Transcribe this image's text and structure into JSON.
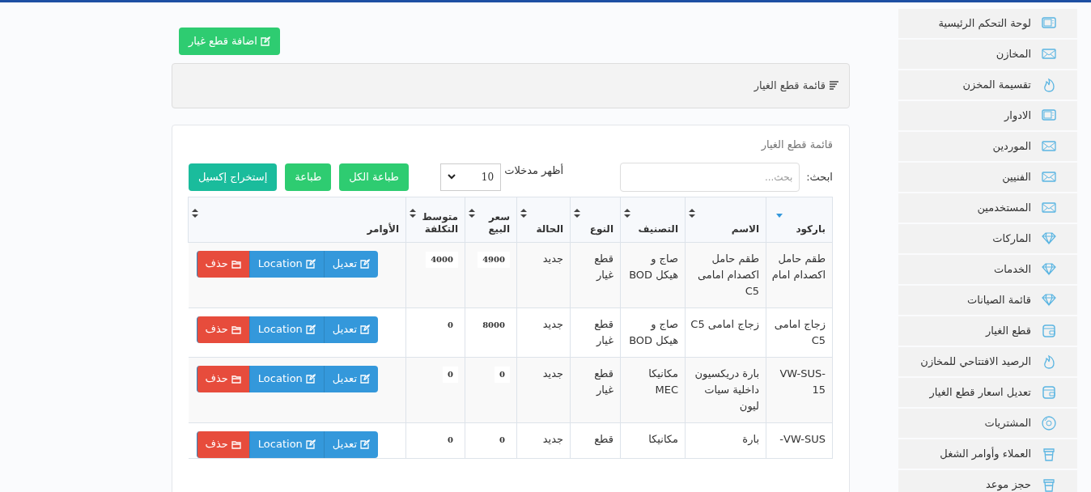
{
  "sidebar": {
    "items": [
      {
        "label": "لوحة التحكم الرئيسية",
        "kind": "monitor"
      },
      {
        "label": "المخازن",
        "kind": "envelope"
      },
      {
        "label": "تقسيمة المخزن",
        "kind": "fire"
      },
      {
        "label": "الادوار",
        "kind": "monitor"
      },
      {
        "label": "الموردين",
        "kind": "envelope"
      },
      {
        "label": "الفنيين",
        "kind": "envelope"
      },
      {
        "label": "المستخدمين",
        "kind": "envelope"
      },
      {
        "label": "الماركات",
        "kind": "diamond"
      },
      {
        "label": "الخدمات",
        "kind": "diamond"
      },
      {
        "label": "قائمة الصيانات",
        "kind": "diamond"
      },
      {
        "label": "قطع الغيار",
        "kind": "wallet"
      },
      {
        "label": "الرصيد الافتتاحي للمخازن",
        "kind": "fire"
      },
      {
        "label": "تعديل اسعار قطع الغيار",
        "kind": "wallet"
      },
      {
        "label": "المشتريات",
        "kind": "disc"
      },
      {
        "label": "العملاء وأوامر الشغل",
        "kind": "cup"
      },
      {
        "label": "حجز موعد",
        "kind": "cup"
      }
    ]
  },
  "add_button": "اضافة قطع غيار",
  "header_panel": {
    "title": "قائمة قطع الغيار"
  },
  "card": {
    "title": "قائمة قطع الغيار",
    "search": {
      "label": "ابحث:",
      "placeholder": "بحث..."
    },
    "page_length": {
      "label": "أظهر مدخلات",
      "value": "10"
    },
    "buttons": [
      "طباعة الكل",
      "طباعة",
      "إستخراج إكسيل"
    ],
    "table": {
      "columns": [
        {
          "label": "باركود",
          "sorted": true
        },
        {
          "label": "الاسم",
          "sorted": false
        },
        {
          "label": "التصنيف",
          "sorted": false
        },
        {
          "label": "النوع",
          "sorted": false
        },
        {
          "label": "الحالة",
          "sorted": false
        },
        {
          "label": "سعر البيع",
          "sorted": false
        },
        {
          "label": "متوسط التكلفة",
          "sorted": false
        },
        {
          "label": "الأوامر",
          "sorted": false
        }
      ],
      "rows": [
        {
          "cells": [
            "طقم حامل اكصدام امام",
            "طقم حامل اكصدام امامى C5",
            "صاج و هيكل BOD",
            "قطع غيار",
            "جديد",
            "4900",
            "4000"
          ],
          "actions": [
            "تعديل",
            "Location",
            "حذف"
          ]
        },
        {
          "cells": [
            "زجاج امامى C5",
            "زجاج امامى C5",
            "صاج و هيكل BOD",
            "قطع غيار",
            "جديد",
            "8000",
            "0"
          ],
          "actions": [
            "تعديل",
            "Location",
            "حذف"
          ]
        },
        {
          "cells": [
            "VW-SUS-15",
            "بارة دريكسيون داخلية سيات ليون",
            "مكانيكا MEC",
            "قطع غيار",
            "جديد",
            "0",
            "0"
          ],
          "actions": [
            "تعديل",
            "Location",
            "حذف"
          ]
        },
        {
          "cells": [
            "VW-SUS-",
            "بارة",
            "مكانيكا",
            "قطع",
            "جديد",
            "0",
            "0"
          ],
          "actions": [
            "تعديل",
            "Location",
            "حذف"
          ]
        }
      ]
    }
  }
}
